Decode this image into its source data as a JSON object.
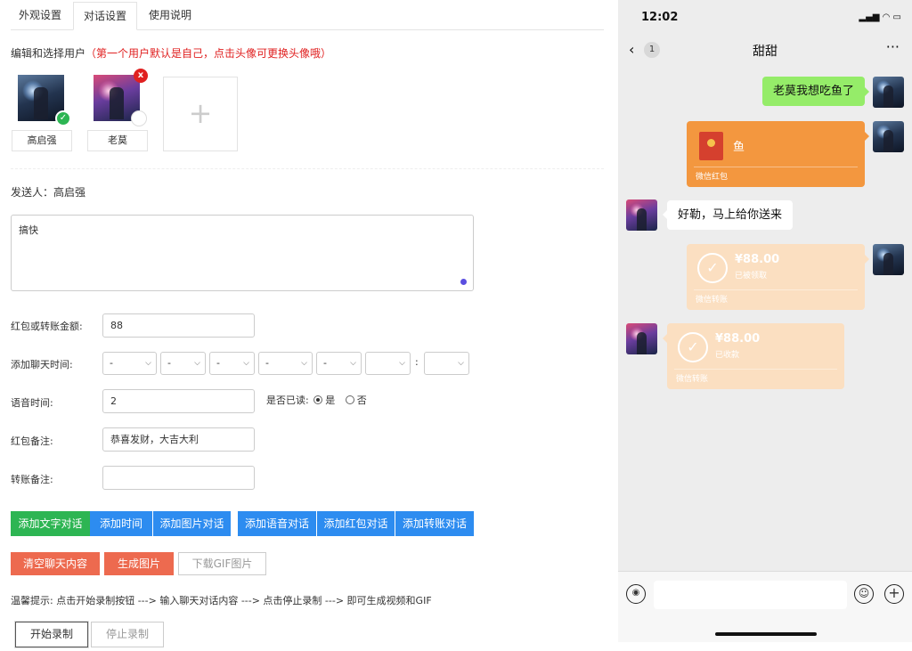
{
  "tabs": [
    "外观设置",
    "对话设置",
    "使用说明"
  ],
  "users_section": {
    "label": "编辑和选择用户",
    "hint": "（第一个用户默认是自己，点击头像可更换头像哦）"
  },
  "users": [
    {
      "name": "高启强",
      "selected": true
    },
    {
      "name": "老莫",
      "selected": false,
      "remove_label": "x"
    }
  ],
  "add_user_icon": "+",
  "sender": {
    "label": "发送人：",
    "name": "高启强"
  },
  "message_text": "搞快",
  "form": {
    "amount_label": "红包或转账金额:",
    "amount_value": "88",
    "time_label": "添加聊天时间:",
    "time_selects": [
      "-",
      "-",
      "-",
      "-",
      "-",
      "",
      ""
    ],
    "time_colon": ":",
    "voice_label": "语音时间:",
    "voice_value": "2",
    "read_label": "是否已读:",
    "read_yes": "是",
    "read_no": "否",
    "redpacket_note_label": "红包备注:",
    "redpacket_note_value": "恭喜发财，大吉大利",
    "transfer_note_label": "转账备注:",
    "transfer_note_value": ""
  },
  "buttons": {
    "add_text": "添加文字对话",
    "add_time": "添加时间",
    "add_image": "添加图片对话",
    "add_voice": "添加语音对话",
    "add_redpacket": "添加红包对话",
    "add_transfer": "添加转账对话",
    "clear": "清空聊天内容",
    "generate": "生成图片",
    "download_gif": "下载GIF图片",
    "start_record": "开始录制",
    "stop_record": "停止录制"
  },
  "tip": "温馨提示: 点击开始录制按钮 ---> 输入聊天对话内容 ---> 点击停止录制 ---> 即可生成视频和GIF",
  "phone": {
    "time": "12:02",
    "status_icons": "▂▄▆ ◠ ▭",
    "back_icon": "‹",
    "unread": "1",
    "chat_title": "甜甜",
    "more_icon": "···",
    "messages": [
      {
        "type": "text",
        "from": "me",
        "text": "老莫我想吃鱼了"
      },
      {
        "type": "redpacket",
        "from": "me",
        "title": "鱼",
        "footer": "微信红包"
      },
      {
        "type": "text",
        "from": "other",
        "text": "好勒，马上给你送来"
      },
      {
        "type": "transfer",
        "from": "me",
        "amount": "¥88.00",
        "status": "已被领取",
        "footer": "微信转账"
      },
      {
        "type": "transfer",
        "from": "other",
        "amount": "¥88.00",
        "status": "已收款",
        "footer": "微信转账"
      }
    ],
    "voice_icon": "◉",
    "emoji_icon": "☺",
    "plus_icon": "+"
  },
  "colors": {
    "green": "#2db553",
    "blue": "#2d8cf0",
    "red": "#ed6a4f",
    "hint_red": "#e02020",
    "wechat_green": "#95ec69",
    "redpacket_orange": "#f3973f",
    "transfer_faded": "#fbdfc1"
  }
}
